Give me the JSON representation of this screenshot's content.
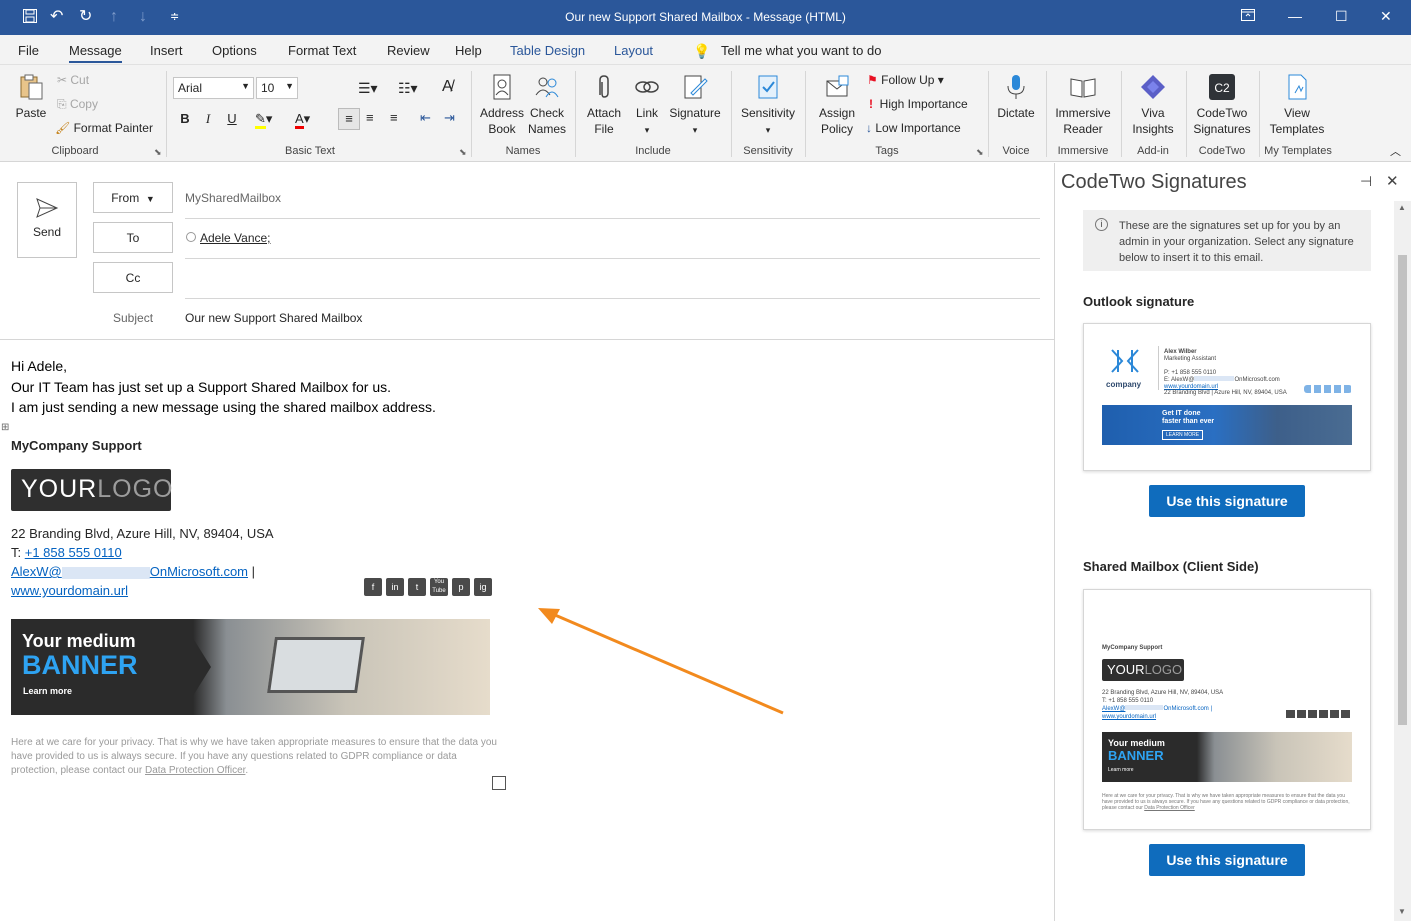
{
  "window": {
    "title": "Our new Support Shared Mailbox  -  Message (HTML)"
  },
  "menu": {
    "items": [
      "File",
      "Message",
      "Insert",
      "Options",
      "Format Text",
      "Review",
      "Help",
      "Table Design",
      "Layout"
    ],
    "tell_me": "Tell me what you want to do"
  },
  "ribbon": {
    "clipboard": {
      "paste": "Paste",
      "cut": "Cut",
      "copy": "Copy",
      "format_painter": "Format Painter",
      "label": "Clipboard"
    },
    "basic_text": {
      "font": "Arial",
      "size": "10",
      "bold": "B",
      "italic": "I",
      "underline": "U",
      "label": "Basic Text"
    },
    "names": {
      "address_book": "Address Book",
      "check_names": "Check Names",
      "label": "Names"
    },
    "include": {
      "attach_file": "Attach File",
      "link": "Link",
      "signature": "Signature",
      "label": "Include"
    },
    "sensitivity": {
      "button": "Sensitivity",
      "label": "Sensitivity"
    },
    "tags": {
      "assign_policy": "Assign Policy",
      "follow_up": "Follow Up",
      "high_importance": "High Importance",
      "low_importance": "Low Importance",
      "label": "Tags"
    },
    "voice": {
      "dictate": "Dictate",
      "label": "Voice"
    },
    "immersive": {
      "reader": "Immersive Reader",
      "label": "Immersive"
    },
    "addin": {
      "viva": "Viva Insights",
      "label": "Add-in"
    },
    "codetwo": {
      "signatures": "CodeTwo Signatures",
      "label": "CodeTwo"
    },
    "templates": {
      "view": "View Templates",
      "label": "My Templates"
    }
  },
  "compose": {
    "send": "Send",
    "from_label": "From",
    "from_value": "MySharedMailbox",
    "to_label": "To",
    "to_value": "Adele Vance;",
    "cc_label": "Cc",
    "subject_label": "Subject",
    "subject_value": "Our new Support Shared Mailbox",
    "body": [
      "Hi Adele,",
      "Our IT Team has just set up a Support Shared Mailbox for us.",
      "I am just sending a new message using the shared mailbox address."
    ],
    "signature": {
      "company": "MyCompany Support",
      "logo_a": "YOUR",
      "logo_b": "LOGO",
      "address": "22 Branding Blvd, Azure Hill, NV, 89404, USA",
      "phone_label": "T:",
      "phone": "+1 858 555 0110",
      "email_a": "AlexW@",
      "email_b": "OnMicrosoft.com",
      "email_sep": "|",
      "website": "www.yourdomain.url",
      "banner_line1": "Your medium",
      "banner_line2": "BANNER",
      "banner_cta": "Learn more",
      "privacy": "Here at we care for your privacy. That is why we have taken appropriate measures to ensure that the data you have provided to us is always secure. If you have any questions related to GDPR compliance or data protection, please contact our",
      "privacy_link": "Data Protection Officer",
      "privacy_end": ".",
      "social": [
        "f",
        "in",
        "t",
        "You Tube",
        "p",
        "ig"
      ]
    }
  },
  "pane": {
    "title": "CodeTwo Signatures",
    "info": "These are the signatures set up for you by an admin in your organization. Select any signature below to insert it to this email.",
    "section1": "Outlook signature",
    "section2": "Shared Mailbox (Client Side)",
    "use_button": "Use this signature",
    "card1": {
      "name": "Alex Wilber",
      "role": "Marketing Assistant",
      "phone": "P: +1 858 555 0110",
      "email": "E: AlexW@",
      "email_b": "OnMicrosoft.com",
      "web": "www.yourdomain.url",
      "address": "22 Branding Blvd | Azure Hill, NV, 89404, USA",
      "brand": "company",
      "banner1": "Get IT done",
      "banner2": "faster than ever",
      "cta": "LEARN MORE"
    },
    "card2": {
      "company": "MyCompany Support",
      "logo_a": "YOUR",
      "logo_b": "LOGO",
      "address": "22 Branding Blvd, Azure Hill, NV, 89404, USA",
      "phone": "T: +1 858 555 0110",
      "email_a": "AlexW@",
      "email_b": "OnMicrosoft.com |",
      "web": "www.yourdomain.url",
      "banner1": "Your medium",
      "banner2": "BANNER",
      "cta": "Learn more",
      "privacy": "Here at we care for your privacy. That is why we have taken appropriate measures to ensure that the data you have provided to us is always secure. If you have any questions related to GDPR compliance or data protection, please contact our",
      "privacy_link": "Data Protection Officer"
    }
  },
  "colors": {
    "titlebar": "#2b579a",
    "accent": "#0f6cbd",
    "arrow": "#f28a1e"
  }
}
